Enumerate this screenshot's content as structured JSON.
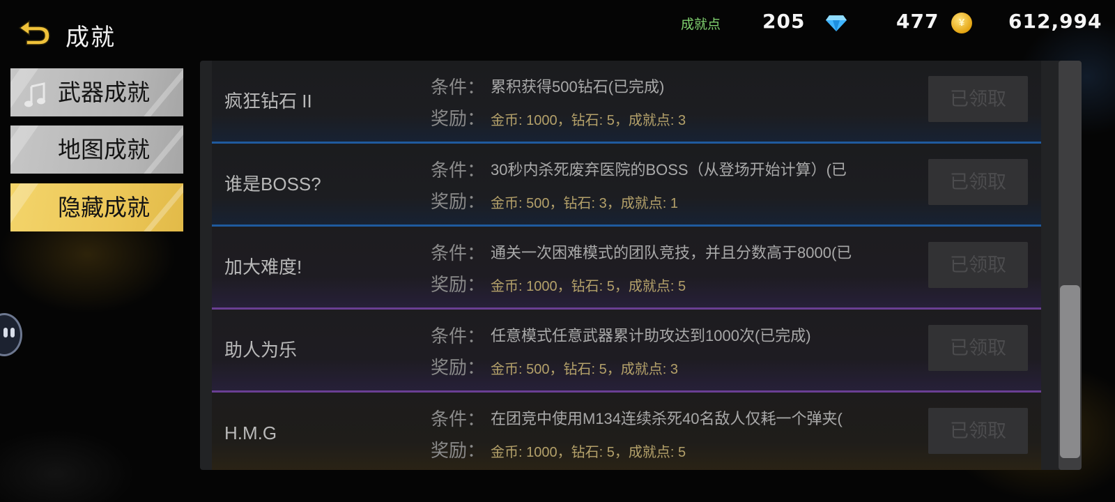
{
  "header": {
    "title": "成就",
    "points_label": "成就点",
    "points_value": "205",
    "diamond_value": "477",
    "gold_value": "612,994",
    "coin_glyph": "¥"
  },
  "tabs": [
    {
      "label": "武器成就",
      "state": "inactive"
    },
    {
      "label": "地图成就",
      "state": "inactive"
    },
    {
      "label": "隐藏成就",
      "state": "active"
    }
  ],
  "labels": {
    "condition": "条件：",
    "reward": "奖励："
  },
  "achievements": [
    {
      "name": "疯狂钻石 II",
      "condition": "累积获得500钻石(已完成)",
      "reward": "金币: 1000，钻石: 5，成就点: 3",
      "button": "已领取"
    },
    {
      "name": "谁是BOSS?",
      "condition": "30秒内杀死废弃医院的BOSS（从登场开始计算）(已",
      "reward": "金币: 500，钻石: 3，成就点: 1",
      "button": "已领取"
    },
    {
      "name": "加大难度!",
      "condition": "通关一次困难模式的团队竞技，并且分数高于8000(已",
      "reward": "金币: 1000，钻石: 5，成就点: 5",
      "button": "已领取"
    },
    {
      "name": "助人为乐",
      "condition": "任意模式任意武器累计助攻达到1000次(已完成)",
      "reward": "金币: 500，钻石: 5，成就点: 3",
      "button": "已领取"
    },
    {
      "name": "H.M.G",
      "condition": "在团竞中使用M134连续杀死40名敌人仅耗一个弹夹(",
      "reward": "金币: 1000，钻石: 5，成就点: 5",
      "button": "已领取"
    }
  ],
  "colors": {
    "accent_yellow": "#ecc758",
    "points_green": "#7fd06e",
    "reward_gold": "#b4a16a",
    "divider_blue": "#1f5a9e",
    "divider_purple": "#6a3f93"
  },
  "icons": {
    "back": "back-arrow-icon",
    "diamond": "diamond-icon",
    "coin": "gold-coin-icon",
    "note": "music-note-icon"
  }
}
